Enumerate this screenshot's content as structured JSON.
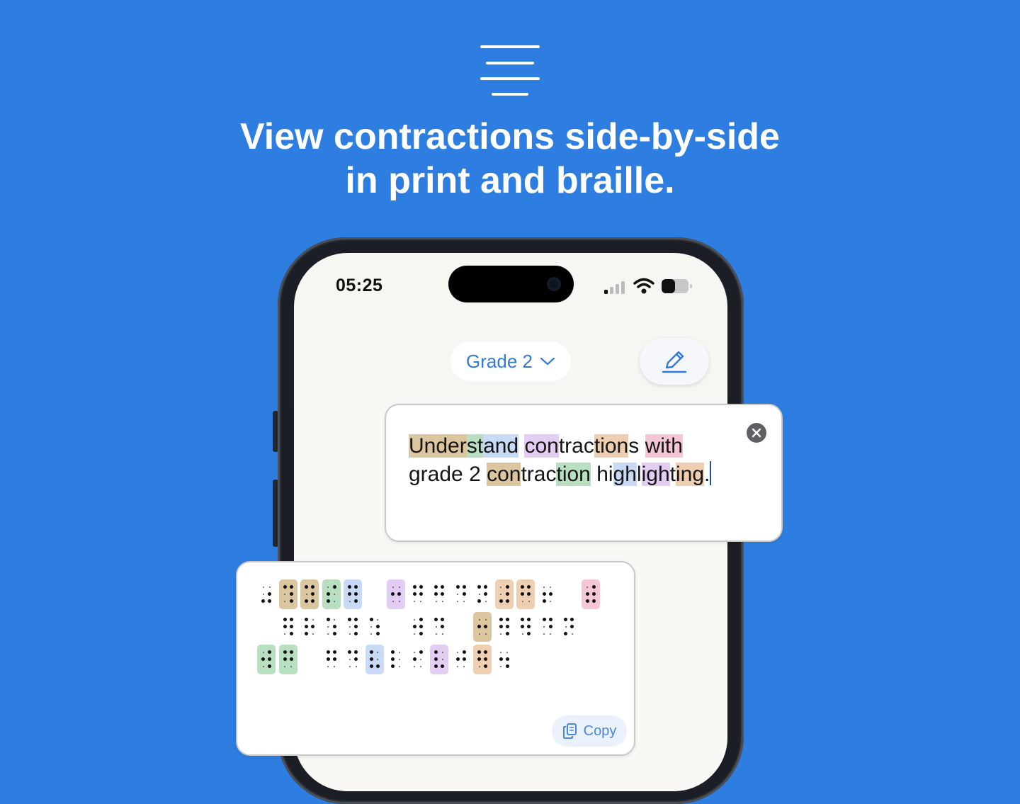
{
  "headline": {
    "line1": "View contractions side-by-side",
    "line2": "in print and braille."
  },
  "status_bar": {
    "time": "05:25",
    "signal_icon": "cellular-signal-icon",
    "wifi_icon": "wifi-icon",
    "battery_icon": "battery-icon",
    "battery_level": 0.5
  },
  "toolbar": {
    "grade_label": "Grade 2",
    "grade_icon": "chevron-down-icon",
    "edit_icon": "pencil-icon"
  },
  "print_card": {
    "close_icon": "close-icon",
    "segments": [
      {
        "t": "Under",
        "h": "tan"
      },
      {
        "t": "st",
        "h": "green"
      },
      {
        "t": "and",
        "h": "blue"
      },
      {
        "t": " ",
        "h": ""
      },
      {
        "t": "con",
        "h": "purple"
      },
      {
        "t": "trac",
        "h": ""
      },
      {
        "t": "tion",
        "h": "peach"
      },
      {
        "t": "s ",
        "h": ""
      },
      {
        "t": "with",
        "h": "pink"
      },
      {
        "t": "\n",
        "h": ""
      },
      {
        "t": "grade 2 ",
        "h": ""
      },
      {
        "t": "con",
        "h": "tan"
      },
      {
        "t": "trac",
        "h": ""
      },
      {
        "t": "tion",
        "h": "green"
      },
      {
        "t": " hi",
        "h": ""
      },
      {
        "t": "gh",
        "h": "blue"
      },
      {
        "t": "l",
        "h": ""
      },
      {
        "t": "igh",
        "h": "purple"
      },
      {
        "t": "t",
        "h": ""
      },
      {
        "t": "ing",
        "h": "peach"
      },
      {
        "t": ".",
        "h": ""
      }
    ]
  },
  "braille_card": {
    "copy_label": "Copy",
    "copy_icon": "copy-documents-icon",
    "cells": [
      {
        "row": 0,
        "col": 0,
        "dots": [
          3,
          5,
          6
        ],
        "h": ""
      },
      {
        "row": 0,
        "col": 1,
        "dots": [
          1,
          4,
          5,
          6
        ],
        "h": "tan"
      },
      {
        "row": 0,
        "col": 2,
        "dots": [
          1,
          3,
          4,
          5,
          6
        ],
        "h": "tan"
      },
      {
        "row": 0,
        "col": 3,
        "dots": [
          2,
          3,
          4
        ],
        "h": "green"
      },
      {
        "row": 0,
        "col": 4,
        "dots": [
          1,
          2,
          4,
          5,
          6
        ],
        "h": "blue"
      },
      {
        "row": 0,
        "col": 6,
        "dots": [
          2,
          5
        ],
        "h": "purple"
      },
      {
        "row": 0,
        "col": 7,
        "dots": [
          1,
          2,
          4,
          5
        ],
        "h": ""
      },
      {
        "row": 0,
        "col": 8,
        "dots": [
          1,
          2,
          4,
          5
        ],
        "h": ""
      },
      {
        "row": 0,
        "col": 9,
        "dots": [
          1,
          4,
          5
        ],
        "h": ""
      },
      {
        "row": 0,
        "col": 10,
        "dots": [
          1,
          3,
          4,
          5
        ],
        "h": ""
      },
      {
        "row": 0,
        "col": 11,
        "dots": [
          3,
          4,
          5,
          6
        ],
        "h": "peach"
      },
      {
        "row": 0,
        "col": 12,
        "dots": [
          1,
          2,
          4,
          5
        ],
        "h": "peach"
      },
      {
        "row": 0,
        "col": 13,
        "dots": [
          2,
          3,
          5
        ],
        "h": ""
      },
      {
        "row": 0,
        "col": 15,
        "dots": [
          2,
          3,
          4,
          5,
          6
        ],
        "h": "pink"
      },
      {
        "row": 1,
        "col": 1,
        "dots": [
          1,
          2,
          4,
          5,
          6
        ],
        "h": ""
      },
      {
        "row": 1,
        "col": 2,
        "dots": [
          1,
          2,
          3,
          5
        ],
        "h": ""
      },
      {
        "row": 1,
        "col": 3,
        "dots": [
          1,
          5,
          6
        ],
        "h": ""
      },
      {
        "row": 1,
        "col": 4,
        "dots": [
          1,
          4,
          5,
          6
        ],
        "h": ""
      },
      {
        "row": 1,
        "col": 5,
        "dots": [
          1,
          5,
          6
        ],
        "h": ""
      },
      {
        "row": 1,
        "col": 7,
        "dots": [
          2,
          4,
          5,
          6
        ],
        "h": ""
      },
      {
        "row": 1,
        "col": 8,
        "dots": [
          1,
          4,
          5
        ],
        "h": ""
      },
      {
        "row": 1,
        "col": 10,
        "dots": [
          2,
          5
        ],
        "h": "tan"
      },
      {
        "row": 1,
        "col": 11,
        "dots": [
          1,
          2,
          4,
          5,
          6
        ],
        "h": ""
      },
      {
        "row": 1,
        "col": 12,
        "dots": [
          1,
          2,
          4,
          5,
          6
        ],
        "h": ""
      },
      {
        "row": 1,
        "col": 13,
        "dots": [
          1,
          4,
          5
        ],
        "h": ""
      },
      {
        "row": 1,
        "col": 14,
        "dots": [
          1,
          3,
          4,
          5
        ],
        "h": ""
      },
      {
        "row": 2,
        "col": 0,
        "dots": [
          2,
          4,
          5,
          6
        ],
        "h": "green"
      },
      {
        "row": 2,
        "col": 1,
        "dots": [
          1,
          2,
          4,
          5
        ],
        "h": "green"
      },
      {
        "row": 2,
        "col": 3,
        "dots": [
          1,
          2,
          4,
          5
        ],
        "h": ""
      },
      {
        "row": 2,
        "col": 4,
        "dots": [
          1,
          4,
          5
        ],
        "h": ""
      },
      {
        "row": 2,
        "col": 5,
        "dots": [
          1,
          2,
          3,
          6
        ],
        "h": "blue"
      },
      {
        "row": 2,
        "col": 6,
        "dots": [
          1,
          2,
          3
        ],
        "h": ""
      },
      {
        "row": 2,
        "col": 7,
        "dots": [
          2,
          4
        ],
        "h": ""
      },
      {
        "row": 2,
        "col": 8,
        "dots": [
          1,
          2,
          3,
          6
        ],
        "h": "purple"
      },
      {
        "row": 2,
        "col": 9,
        "dots": [
          2,
          4,
          5
        ],
        "h": ""
      },
      {
        "row": 2,
        "col": 10,
        "dots": [
          1,
          2,
          4,
          5,
          6
        ],
        "h": "peach"
      },
      {
        "row": 2,
        "col": 11,
        "dots": [
          2,
          5,
          6
        ],
        "h": ""
      }
    ]
  },
  "colors": {
    "background": "#2d7ee0",
    "accent": "#2f7bd6",
    "tan": "#dcc6a0",
    "green": "#b8dfc0",
    "blue": "#c8daf6",
    "purple": "#e4cdf2",
    "peach": "#efcfb2",
    "pink": "#f5c6d6"
  }
}
